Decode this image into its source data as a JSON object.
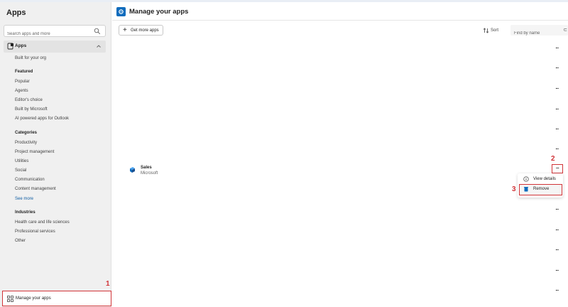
{
  "sidebar": {
    "title": "Apps",
    "search_placeholder": "Search apps and more",
    "apps_section": "Apps",
    "built_for_org": "Built for your org",
    "featured_heading": "Featured",
    "featured": [
      "Popular",
      "Agents",
      "Editor's choice",
      "Built by Microsoft",
      "AI powered apps for Outlook"
    ],
    "categories_heading": "Categories",
    "categories": [
      "Productivity",
      "Project management",
      "Utilities",
      "Social",
      "Communication",
      "Content management"
    ],
    "see_more": "See more",
    "industries_heading": "Industries",
    "industries": [
      "Health care and life sciences",
      "Professional services",
      "Other"
    ],
    "manage_label": "Manage your apps"
  },
  "main": {
    "title": "Manage your apps",
    "get_more_label": "Get more apps",
    "sort_label": "Sort",
    "find_placeholder": "Find by name",
    "app": {
      "name": "Sales",
      "publisher": "Microsoft"
    },
    "more_label": "...",
    "menu": {
      "view_details": "View details",
      "remove": "Remove"
    }
  },
  "annotations": {
    "step1": "1",
    "step2": "2",
    "step3": "3"
  },
  "colors": {
    "accent": "#0f6cbd",
    "highlight": "#d13438",
    "sidebar_bg": "#f0f0f0"
  }
}
